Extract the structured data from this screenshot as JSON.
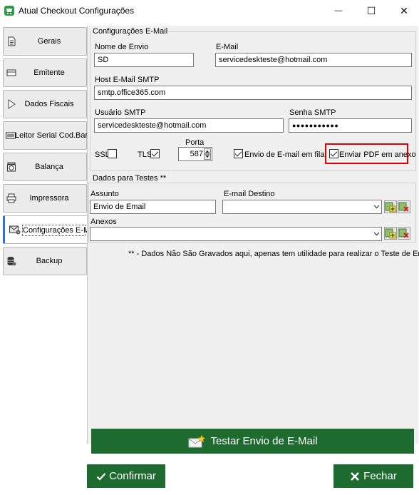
{
  "window": {
    "title": "Atual Checkout Configurações",
    "minimize_glyph": "—",
    "maximize_glyph": "☐",
    "close_glyph": "✕"
  },
  "tabs": [
    {
      "label": "Gerais",
      "icon": "document-icon"
    },
    {
      "label": "Emitente",
      "icon": "id-card-icon"
    },
    {
      "label": "Dados Fiscais",
      "icon": "play-icon"
    },
    {
      "label": "Leitor Serial Cod.Barra",
      "icon": "barcode-scanner-icon"
    },
    {
      "label": "Balança",
      "icon": "scale-icon"
    },
    {
      "label": "Impressora",
      "icon": "printer-icon"
    },
    {
      "label": "Configurações E-Mail",
      "icon": "email-settings-icon"
    },
    {
      "label": "Backup",
      "icon": "database-icon"
    }
  ],
  "email_config": {
    "group_title": "Configurações E-Mail",
    "sender_name_label": "Nome de Envio",
    "sender_name_value": "SD",
    "email_label": "E-Mail",
    "email_value": "servicedeskteste@hotmail.com",
    "smtp_host_label": "Host E-Mail SMTP",
    "smtp_host_value": "smtp.office365.com",
    "smtp_user_label": "Usuário SMTP",
    "smtp_user_value": "servicedeskteste@hotmail.com",
    "smtp_password_label": "Senha SMTP",
    "smtp_password_value": "●●●●●●●●●●●",
    "port_label": "Porta",
    "port_value": "587",
    "ssl_label": "SSL",
    "ssl_checked": false,
    "tls_label": "TLS",
    "tls_checked": true,
    "queue_label": "Envio de E-mail em fila",
    "queue_checked": true,
    "attach_pdf_label": "Enviar PDF em anexo",
    "attach_pdf_checked": true,
    "highlight_color": "#e00000"
  },
  "test_data": {
    "group_title": "Dados para Testes **",
    "subject_label": "Assunto",
    "subject_value": "Envio de Email",
    "dest_label": "E-mail Destino",
    "dest_value": "",
    "attachments_label": "Anexos",
    "attachments_value": "",
    "note": "** - Dados Não São Gravados aqui, apenas tem utilidade para realizar o Teste de Email"
  },
  "buttons": {
    "test_label": "Testar Envio de E-Mail",
    "confirm_label": "Confirmar",
    "close_label": "Fechar",
    "green": "#1d6b2f"
  }
}
